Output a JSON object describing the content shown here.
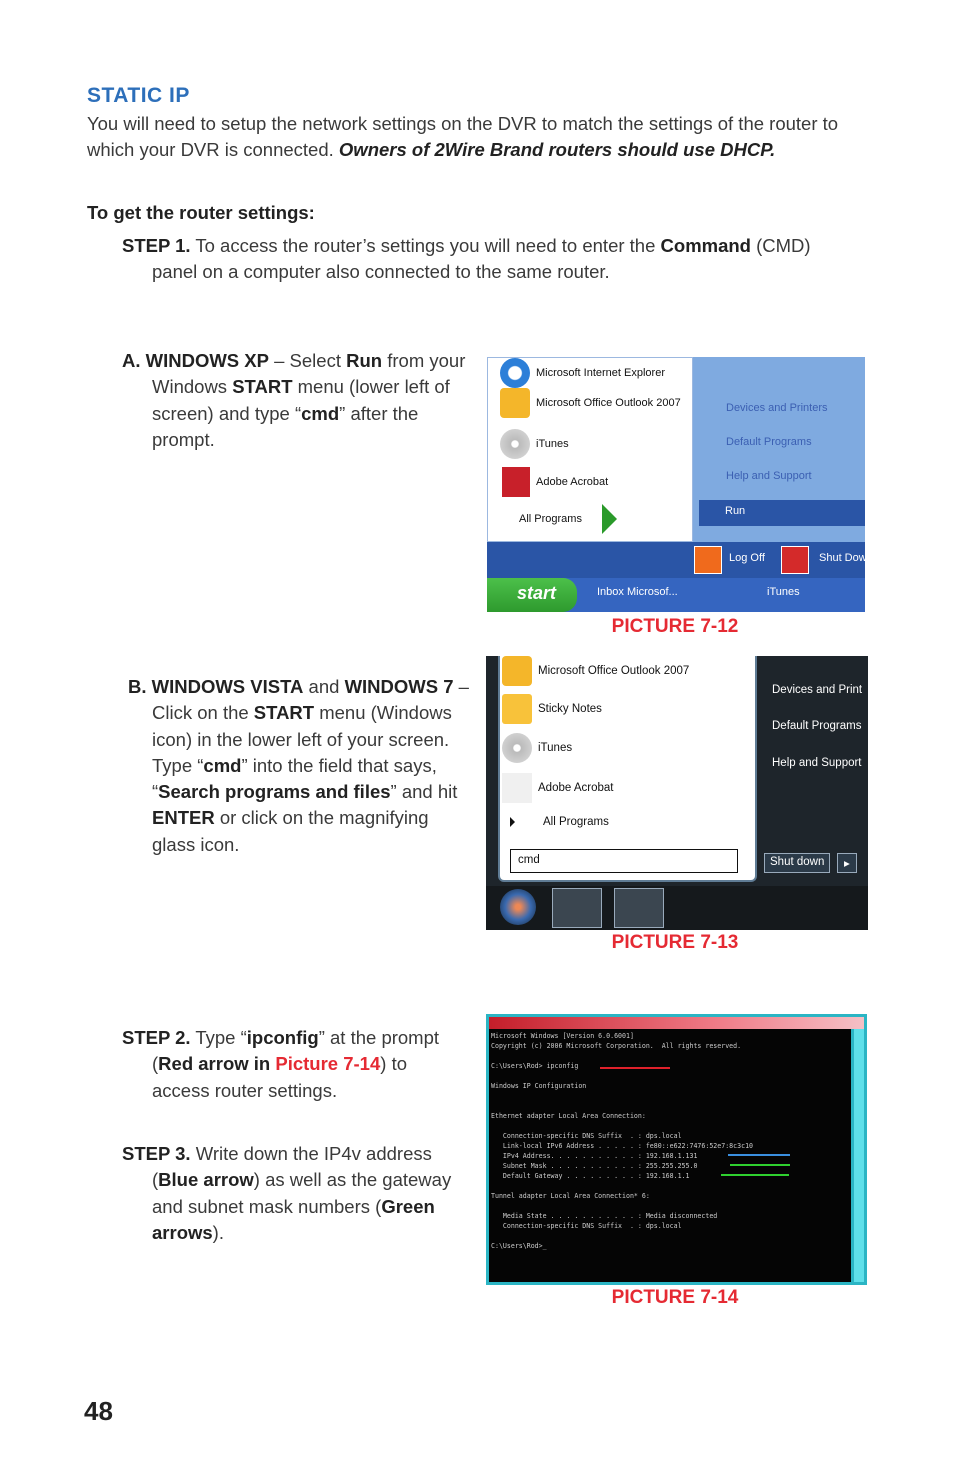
{
  "heading": "STATIC IP",
  "intro": [
    {
      "t": "You will need to setup the network settings on the DVR to match the settings of the router to which your DVR is connected. "
    },
    {
      "t": "Owners of 2Wire Brand routers should use DHCP.",
      "b": 1,
      "i": 1
    }
  ],
  "subheading": "To get the router settings:",
  "step1": [
    {
      "t": "STEP 1.",
      "b": 1
    },
    {
      "t": " To access the router’s settings you will need to enter the "
    },
    {
      "t": "Command",
      "b": 1
    },
    {
      "t": " (CMD) panel on a computer also connected to the same router."
    }
  ],
  "sectionA": [
    {
      "t": "A. WINDOWS XP",
      "b": 1
    },
    {
      "t": " – Select "
    },
    {
      "t": "Run",
      "b": 1
    },
    {
      "t": " from your Windows "
    },
    {
      "t": "START",
      "b": 1
    },
    {
      "t": " menu (lower left of screen) and type “"
    },
    {
      "t": "cmd",
      "b": 1
    },
    {
      "t": "” after the prompt."
    }
  ],
  "sectionB": [
    {
      "t": "B. WINDOWS VISTA",
      "b": 1
    },
    {
      "t": " and "
    },
    {
      "t": "WINDOWS 7",
      "b": 1
    },
    {
      "t": " – Click on the "
    },
    {
      "t": "START",
      "b": 1
    },
    {
      "t": " menu (Windows icon) in the lower left of your screen. Type “"
    },
    {
      "t": "cmd",
      "b": 1
    },
    {
      "t": "” into the field that says, “"
    },
    {
      "t": "Search programs and files",
      "b": 1
    },
    {
      "t": "” and hit "
    },
    {
      "t": "ENTER",
      "b": 1
    },
    {
      "t": " or click on the magnifying glass icon."
    }
  ],
  "step2": [
    {
      "t": "STEP 2.",
      "b": 1
    },
    {
      "t": " Type “"
    },
    {
      "t": "ipconfig",
      "b": 1
    },
    {
      "t": "” at the prompt ("
    },
    {
      "t": "Red arrow in ",
      "b": 1
    },
    {
      "t": "Picture 7-14",
      "b": 1,
      "r": 1
    },
    {
      "t": ") to access router settings."
    }
  ],
  "step3": [
    {
      "t": "STEP 3.",
      "b": 1
    },
    {
      "t": " Write down the IP4v address ("
    },
    {
      "t": "Blue arrow",
      "b": 1
    },
    {
      "t": ") as well as the gateway and subnet mask numbers ("
    },
    {
      "t": "Green arrows",
      "b": 1
    },
    {
      "t": ")."
    }
  ],
  "xp": {
    "items": [
      "Microsoft Internet Explorer",
      "Microsoft Office Outlook 2007",
      "iTunes",
      "Adobe Acrobat"
    ],
    "all_programs": "All Programs",
    "right": [
      "Devices and Printers",
      "Default Programs",
      "Help and Support"
    ],
    "run": "Run",
    "log_off": "Log Off",
    "shut_down": "Shut Dow",
    "start": "start",
    "task": [
      "Inbox Microsof...",
      "iTunes"
    ]
  },
  "vista": {
    "items": [
      "Microsoft Office Outlook 2007",
      "Sticky Notes",
      "iTunes",
      "Adobe Acrobat"
    ],
    "all_programs": "All Programs",
    "right": [
      "Devices and Print",
      "Default Programs",
      "Help and Support"
    ],
    "search_value": "cmd",
    "shut_down": "Shut down"
  },
  "cmd": {
    "lines": [
      "Microsoft Windows [Version 6.0.6001]",
      "Copyright (c) 2006 Microsoft Corporation.  All rights reserved.",
      "",
      "C:\\Users\\Rod> ipconfig",
      "",
      "Windows IP Configuration",
      "",
      "",
      "Ethernet adapter Local Area Connection:",
      "",
      "   Connection-specific DNS Suffix  . : dps.local",
      "   Link-local IPv6 Address . . . . . : fe80::e622:7476:52e7:8c3c10",
      "   IPv4 Address. . . . . . . . . . . : 192.168.1.131",
      "   Subnet Mask . . . . . . . . . . . : 255.255.255.0",
      "   Default Gateway . . . . . . . . . : 192.168.1.1",
      "",
      "Tunnel adapter Local Area Connection* 6:",
      "",
      "   Media State . . . . . . . . . . . : Media disconnected",
      "   Connection-specific DNS Suffix  . : dps.local",
      "",
      "C:\\Users\\Rod>_"
    ],
    "arrow_colors": {
      "red": "#e0212b",
      "blue": "#3a8fe0",
      "green": "#2fd02f"
    }
  },
  "captions": [
    "PICTURE 7-12",
    "PICTURE 7-13",
    "PICTURE 7-14"
  ],
  "page_number": "48"
}
